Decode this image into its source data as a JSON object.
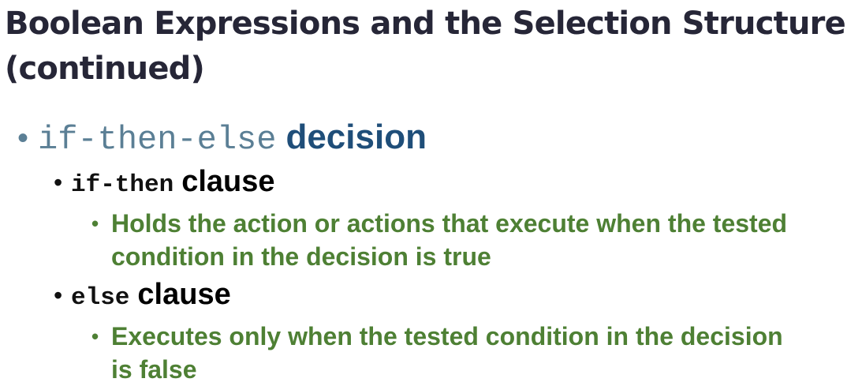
{
  "slide": {
    "title_line1": "Boolean Expressions and the Selection Structure",
    "title_line2": "(continued)"
  },
  "bullets": {
    "level1": {
      "code": "if-then-else",
      "text": "decision"
    },
    "if_then": {
      "code": "if-then",
      "text": "clause",
      "detail": "Holds the action or actions that execute when the tested condition in the decision is true"
    },
    "else": {
      "code": "else",
      "text": "clause",
      "detail": "Executes only when the tested condition in the decision is false"
    }
  },
  "colors": {
    "title": "#262637",
    "level1_code": "#5b7f95",
    "level1_text": "#1f4e79",
    "level2_text": "#000000",
    "level3_text": "#4e8034"
  }
}
